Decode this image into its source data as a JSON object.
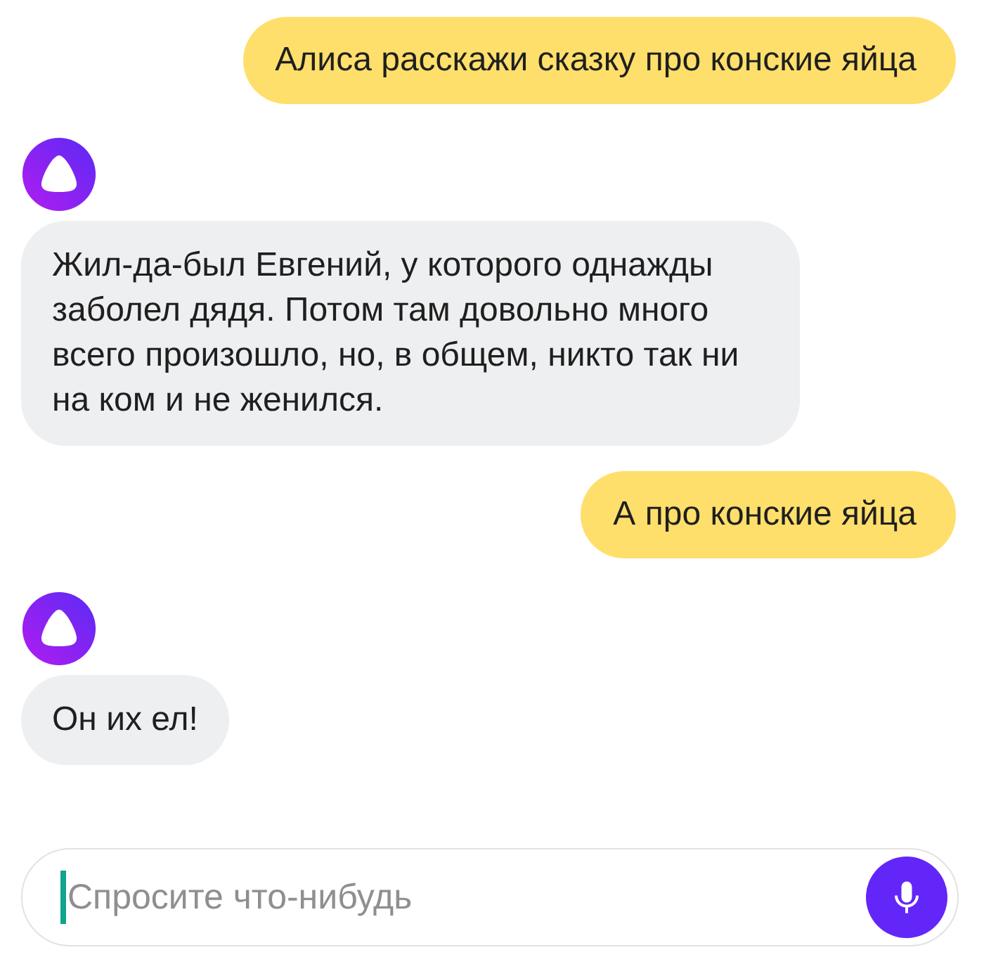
{
  "messages": [
    {
      "kind": "user",
      "text": "Алиса расскажи сказку про конские яйца"
    },
    {
      "kind": "assistant",
      "text": "Жил-да-был Евгений, у которого однажды заболел дядя. Потом там довольно много всего произошло, но, в общем, никто так ни на ком и не женился."
    },
    {
      "kind": "user",
      "text": "А про конские яйца"
    },
    {
      "kind": "assistant",
      "text": "Он их ел!"
    }
  ],
  "input": {
    "placeholder": "Спросите что-нибудь"
  }
}
